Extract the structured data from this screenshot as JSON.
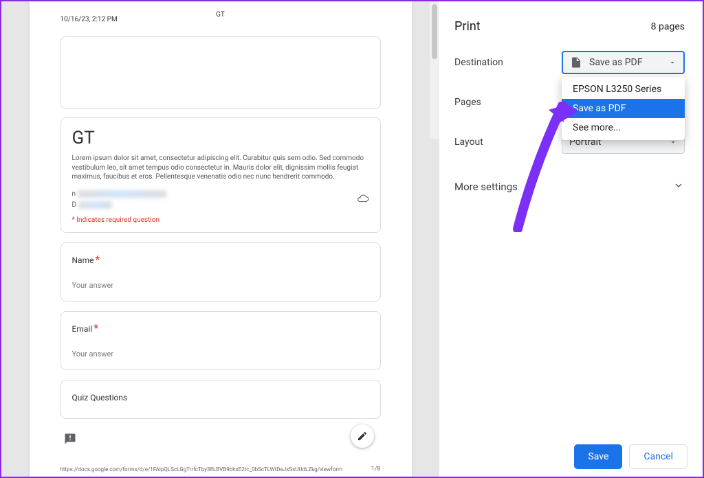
{
  "preview": {
    "timestamp": "10/16/23, 2:12 PM",
    "header_center": "GT",
    "form_title": "GT",
    "lorem": "Lorem ipsum dolor sit amet, consectetur adipiscing elit. Curabitur quis sem odio. Sed commodo vestibulum leo, sit amet tempus odio consectetur in. Mauris dolor elit, dignissim mollis feugiat maximus, faucibus et eros. Pellentesque venenatis odio nec nunc hendrerit commodo.",
    "required_note": "* Indicates required question",
    "q1_label": "Name",
    "q2_label": "Email",
    "q3_label": "Quiz Questions",
    "answer_placeholder": "Your answer",
    "footer_url": "https://docs.google.com/forms/d/e/1FAIpQLScLGgTrrfcTby38LBVB9bhxE2tc_0bScTLWtDeJsSsUUdLZkg/viewform",
    "page_indicator": "1/8"
  },
  "panel": {
    "title": "Print",
    "page_count": "8 pages",
    "rows": {
      "destination_label": "Destination",
      "pages_label": "Pages",
      "layout_label": "Layout",
      "more_label": "More settings"
    },
    "destination": {
      "selected": "Save as PDF",
      "options": [
        "EPSON L3250 Series",
        "Save as PDF",
        "See more..."
      ]
    },
    "layout_value": "Portrait",
    "buttons": {
      "save": "Save",
      "cancel": "Cancel"
    }
  }
}
